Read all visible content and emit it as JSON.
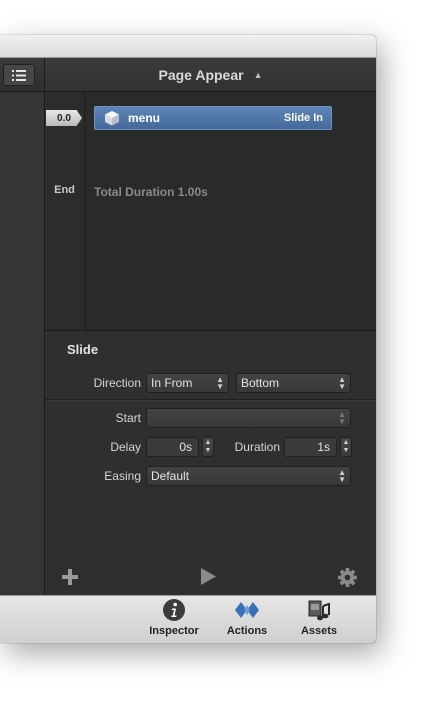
{
  "header": {
    "title": "Page Appear"
  },
  "timeline": {
    "start_time": "0.0",
    "end_label": "End",
    "action": {
      "name": "menu",
      "type": "Slide In"
    },
    "total_duration": "Total Duration 1.00s"
  },
  "inspector": {
    "section_title": "Slide",
    "direction_label": "Direction",
    "direction_mode": "In From",
    "direction_side": "Bottom",
    "start_label": "Start",
    "start_value": "",
    "delay_label": "Delay",
    "delay_value": "0s",
    "duration_label": "Duration",
    "duration_value": "1s",
    "easing_label": "Easing",
    "easing_value": "Default"
  },
  "tabs": [
    {
      "label": "Inspector",
      "icon": "info-icon"
    },
    {
      "label": "Actions",
      "icon": "actions-icon",
      "accent": "#3b6fb6"
    },
    {
      "label": "Assets",
      "icon": "assets-icon"
    }
  ]
}
